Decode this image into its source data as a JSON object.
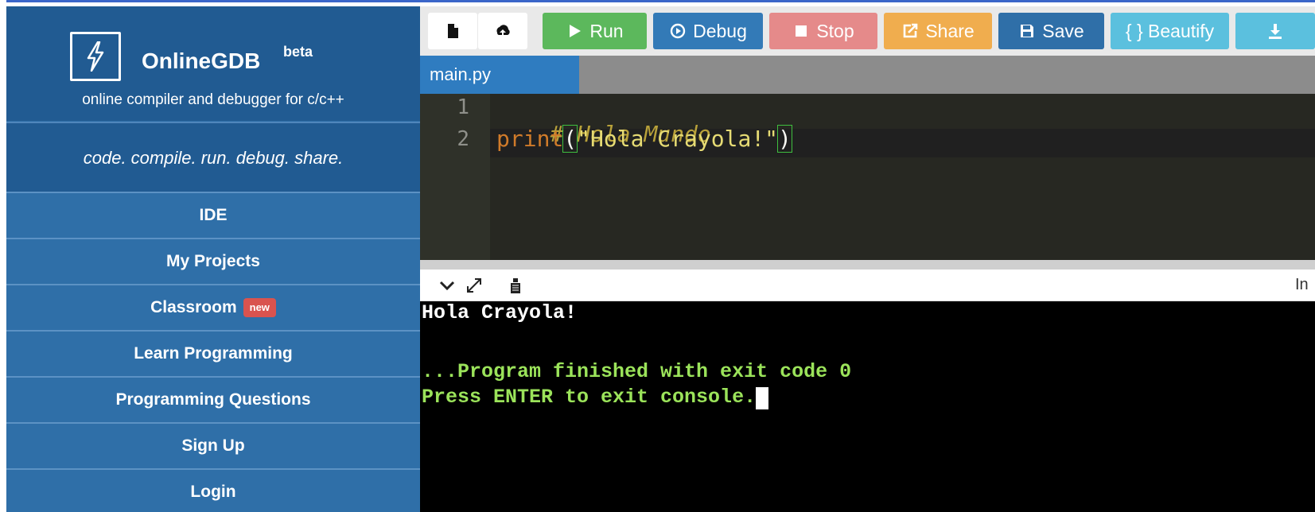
{
  "app": {
    "name": "OnlineGDB",
    "beta": "beta",
    "subtitle": "online compiler and debugger for c/c++",
    "tagline": "code. compile. run. debug. share."
  },
  "sidebar": {
    "items": [
      {
        "label": "IDE"
      },
      {
        "label": "My Projects"
      },
      {
        "label": "Classroom",
        "badge": "new"
      },
      {
        "label": "Learn Programming"
      },
      {
        "label": "Programming Questions"
      },
      {
        "label": "Sign Up"
      },
      {
        "label": "Login"
      }
    ]
  },
  "toolbar": {
    "run_label": "Run",
    "debug_label": "Debug",
    "stop_label": "Stop",
    "share_label": "Share",
    "save_label": "Save",
    "beautify_label": "{ } Beautify"
  },
  "editor": {
    "tab": "main.py",
    "lines": [
      {
        "num": "1",
        "comment": "# Hola Mundo"
      },
      {
        "num": "2",
        "func": "print",
        "open": "(",
        "string": "\"Hola Crayola!\"",
        "close": ")"
      }
    ]
  },
  "console": {
    "header_label": "In",
    "output": "Hola Crayola!",
    "finished": "...Program finished with exit code 0",
    "prompt": "Press ENTER to exit console."
  },
  "colors": {
    "sidebar": "#2f6fa8",
    "brand": "#215b92",
    "run": "#5cb85c",
    "debug": "#337ab7",
    "stop": "#e58a8a",
    "share": "#f0ad4e",
    "beautify": "#5bc0de",
    "console_text": "#9be35a"
  },
  "icons": {
    "logo": "lightning-bolt-icon",
    "new_file": "file-icon",
    "upload": "cloud-upload-icon",
    "run": "play-icon",
    "debug": "debug-circle-icon",
    "stop": "stop-square-icon",
    "share": "share-icon",
    "save": "floppy-icon",
    "download": "download-icon"
  }
}
